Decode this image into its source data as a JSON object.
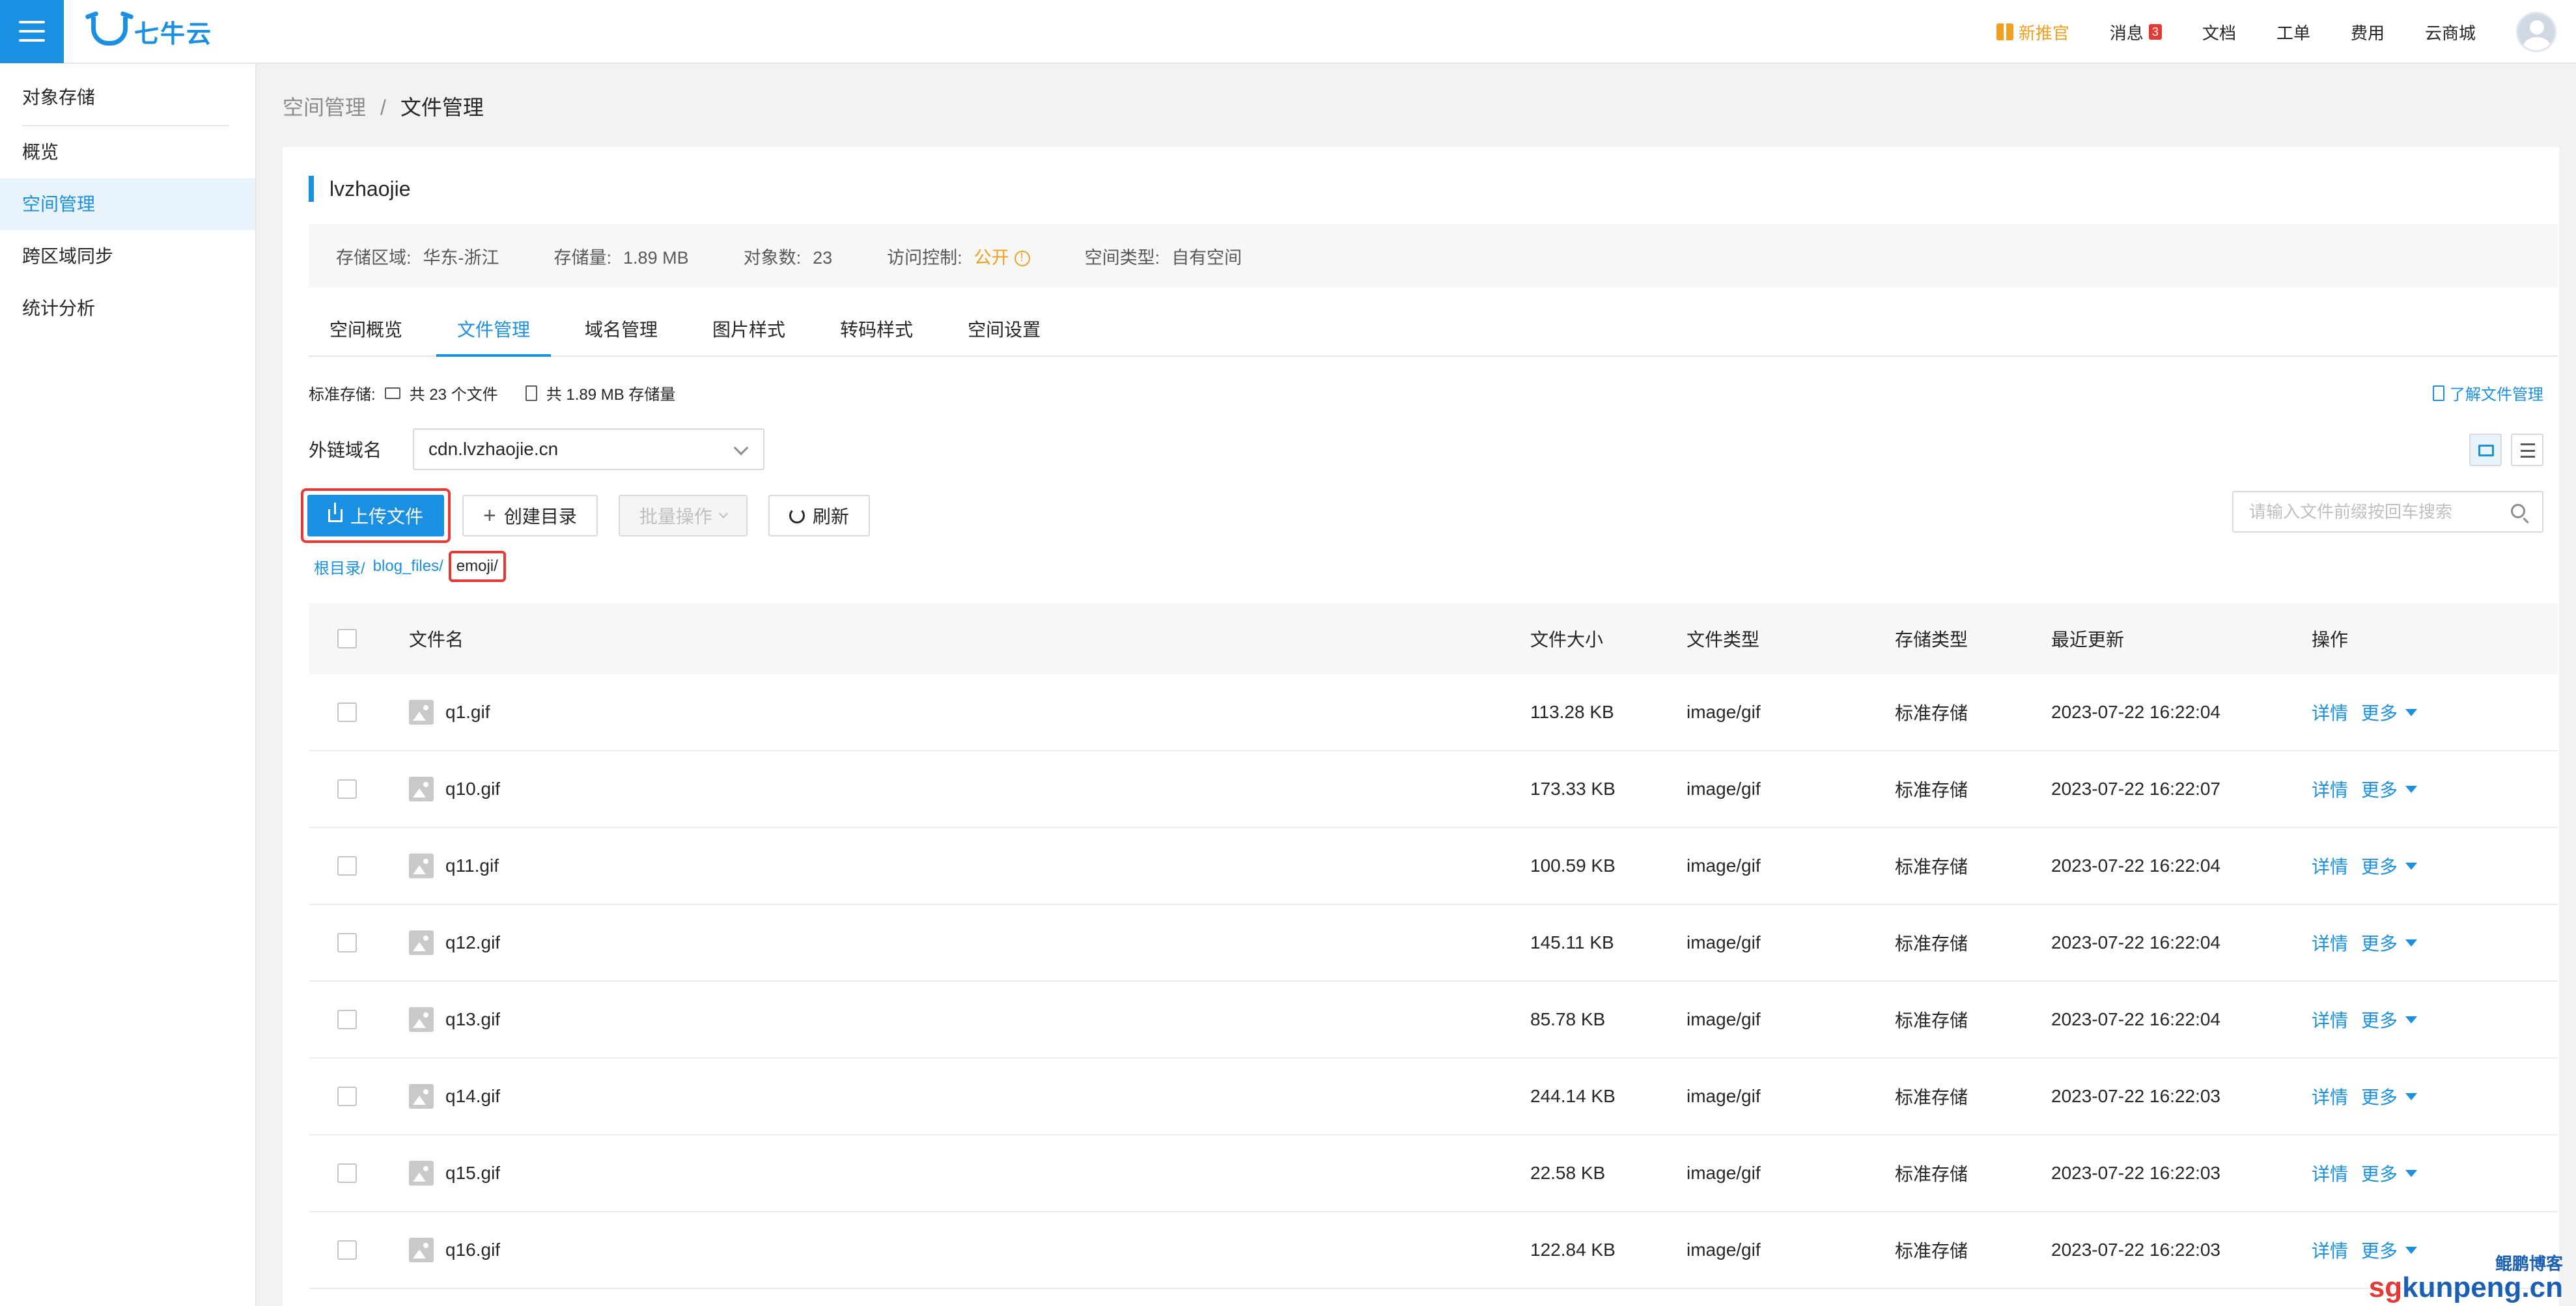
{
  "header": {
    "logo_text": "七牛云",
    "nav": [
      {
        "label": "新推官",
        "icon": "gift-icon"
      },
      {
        "label": "消息",
        "badge": "3"
      },
      {
        "label": "文档"
      },
      {
        "label": "工单"
      },
      {
        "label": "费用"
      },
      {
        "label": "云商城"
      }
    ]
  },
  "sidebar": {
    "title": "对象存储",
    "items": [
      {
        "label": "概览"
      },
      {
        "label": "空间管理",
        "active": true
      },
      {
        "label": "跨区域同步"
      },
      {
        "label": "统计分析"
      }
    ]
  },
  "breadcrumb": {
    "parent": "空间管理",
    "separator": "/",
    "current": "文件管理"
  },
  "bucket": {
    "name": "lvzhaojie",
    "info": [
      {
        "label": "存储区域:",
        "value": "华东-浙江"
      },
      {
        "label": "存储量:",
        "value": "1.89 MB"
      },
      {
        "label": "对象数:",
        "value": "23"
      },
      {
        "label": "访问控制:",
        "value": "公开"
      },
      {
        "label": "空间类型:",
        "value": "自有空间"
      }
    ]
  },
  "tabs": [
    {
      "label": "空间概览"
    },
    {
      "label": "文件管理",
      "active": true
    },
    {
      "label": "域名管理"
    },
    {
      "label": "图片样式"
    },
    {
      "label": "转码样式"
    },
    {
      "label": "空间设置"
    }
  ],
  "stats": {
    "prefix": "标准存储:",
    "files": "共 23 个文件",
    "size": "共 1.89 MB 存储量"
  },
  "learn_link": "了解文件管理",
  "domain": {
    "label": "外链域名",
    "value": "cdn.lvzhaojie.cn"
  },
  "toolbar": {
    "upload": "上传文件",
    "create_dir": "创建目录",
    "batch": "批量操作",
    "refresh": "刷新",
    "search_placeholder": "请输入文件前缀按回车搜索"
  },
  "path": {
    "segments": [
      "根目录/",
      "blog_files/"
    ],
    "current": "emoji/"
  },
  "table": {
    "headers": {
      "name": "文件名",
      "size": "文件大小",
      "type": "文件类型",
      "storage": "存储类型",
      "updated": "最近更新",
      "ops": "操作"
    },
    "op_detail": "详情",
    "op_more": "更多",
    "rows": [
      {
        "name": "q1.gif",
        "size": "113.28 KB",
        "type": "image/gif",
        "storage": "标准存储",
        "updated": "2023-07-22 16:22:04"
      },
      {
        "name": "q10.gif",
        "size": "173.33 KB",
        "type": "image/gif",
        "storage": "标准存储",
        "updated": "2023-07-22 16:22:07"
      },
      {
        "name": "q11.gif",
        "size": "100.59 KB",
        "type": "image/gif",
        "storage": "标准存储",
        "updated": "2023-07-22 16:22:04"
      },
      {
        "name": "q12.gif",
        "size": "145.11 KB",
        "type": "image/gif",
        "storage": "标准存储",
        "updated": "2023-07-22 16:22:04"
      },
      {
        "name": "q13.gif",
        "size": "85.78 KB",
        "type": "image/gif",
        "storage": "标准存储",
        "updated": "2023-07-22 16:22:04"
      },
      {
        "name": "q14.gif",
        "size": "244.14 KB",
        "type": "image/gif",
        "storage": "标准存储",
        "updated": "2023-07-22 16:22:03"
      },
      {
        "name": "q15.gif",
        "size": "22.58 KB",
        "type": "image/gif",
        "storage": "标准存储",
        "updated": "2023-07-22 16:22:03"
      },
      {
        "name": "q16.gif",
        "size": "122.84 KB",
        "type": "image/gif",
        "storage": "标准存储",
        "updated": "2023-07-22 16:22:03"
      }
    ]
  },
  "watermark": {
    "top": "鲲鹏博客",
    "sg": "sg",
    "rest": "kunpeng.cn"
  },
  "colors": {
    "accent": "#1a90e3",
    "highlight": "#e53935",
    "warning": "#f0a020"
  }
}
